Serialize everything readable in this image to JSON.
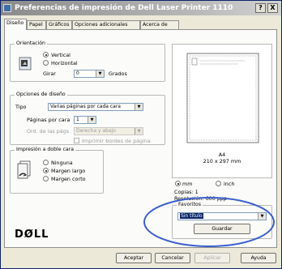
{
  "window": {
    "title": "Preferencias de impresión de Dell Laser Printer 1110"
  },
  "titlebar_buttons": {
    "help": "?",
    "close": "X"
  },
  "tabs": [
    "Diseño",
    "Papel",
    "Gráficos",
    "Opciones adicionales",
    "Acerca de"
  ],
  "orientation": {
    "group_label": "Orientación",
    "options": [
      "Vertical",
      "Horizontal"
    ],
    "selected": "Vertical",
    "rotate_label": "Girar",
    "rotate_value": "0",
    "rotate_unit": "Grados"
  },
  "layout": {
    "group_label": "Opciones de diseño",
    "type_label": "Tipo",
    "type_value": "Varias páginas por cada cara",
    "pages_label": "Páginas por cara",
    "pages_value": "1",
    "order_label": "Ord. de las págs",
    "order_value": "Derecha y abajo",
    "border_label": "Imprimir bordes de página"
  },
  "duplex": {
    "group_label": "Impresión a doble cara",
    "options": [
      "Ninguna",
      "Margen largo",
      "Margen corto"
    ],
    "selected": "Margen largo"
  },
  "preview": {
    "paper_size": "A4",
    "dimensions": "210 x 297 mm",
    "unit_options": [
      "mm",
      "inch"
    ],
    "unit_selected": "mm",
    "copies": "Copias: 1",
    "resolution": "Resolución: 600 ppp"
  },
  "favorites": {
    "label": "Favoritos",
    "value": "Sin título",
    "save_button": "Guardar"
  },
  "brand": "DØLL",
  "footer": {
    "accept": "Aceptar",
    "cancel": "Cancelar",
    "apply": "Aplicar",
    "help": "Ayuda"
  },
  "colors": {
    "annotation_circle": "#3a5fcd",
    "title_gradient_start": "#8a8a8a",
    "selection": "#0a246a"
  }
}
